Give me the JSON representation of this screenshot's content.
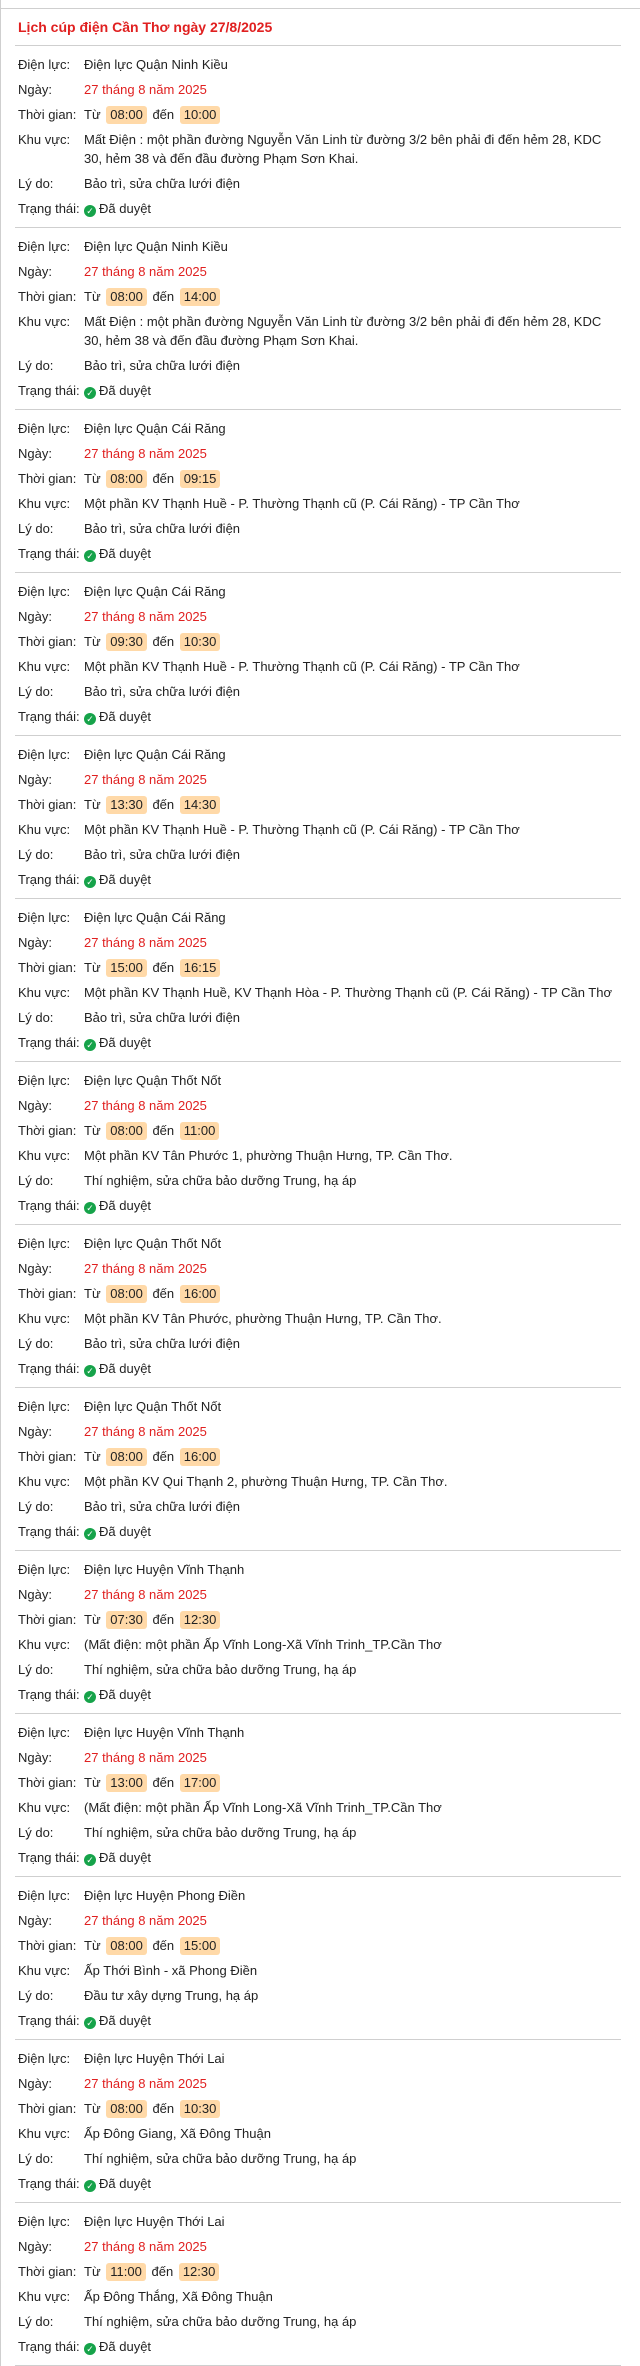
{
  "page": {
    "title": "Lịch cúp điện Cần Thơ ngày 27/8/2025"
  },
  "labels": {
    "unit": "Điện lực:",
    "date": "Ngày:",
    "time": "Thời gian:",
    "from": "Từ",
    "to": "đến",
    "area": "Khu vực:",
    "reason": "Lý do:",
    "status": "Trạng thái:"
  },
  "icons": {
    "status": "check-circle-icon"
  },
  "colors": {
    "title": "#e02020",
    "date": "#e02020",
    "time_badge": "#ffd9a8",
    "approved": "#16a34a"
  },
  "outages": [
    {
      "unit": "Điện lực Quận Ninh Kiều",
      "date": "27 tháng 8 năm 2025",
      "start": "08:00",
      "end": "10:00",
      "area": "Mất Điện : một phần đường Nguyễn Văn Linh từ đường 3/2 bên phải đi đến hẻm 28, KDC 30, hẻm 38 và đến đầu đường Phạm Sơn Khai.",
      "reason": "Bảo trì, sửa chữa lưới điện",
      "status": "Đã duyệt"
    },
    {
      "unit": "Điện lực Quận Ninh Kiều",
      "date": "27 tháng 8 năm 2025",
      "start": "08:00",
      "end": "14:00",
      "area": "Mất Điện : một phần đường Nguyễn Văn Linh từ đường 3/2 bên phải đi đến hẻm 28, KDC 30, hẻm 38 và đến đầu đường Phạm Sơn Khai.",
      "reason": "Bảo trì, sửa chữa lưới điện",
      "status": "Đã duyệt"
    },
    {
      "unit": "Điện lực Quận Cái Răng",
      "date": "27 tháng 8 năm 2025",
      "start": "08:00",
      "end": "09:15",
      "area": "Một phần KV Thạnh Huề - P. Thường Thạnh cũ (P. Cái Răng) - TP Cần Thơ",
      "reason": "Bảo trì, sửa chữa lưới điện",
      "status": "Đã duyệt"
    },
    {
      "unit": "Điện lực Quận Cái Răng",
      "date": "27 tháng 8 năm 2025",
      "start": "09:30",
      "end": "10:30",
      "area": "Một phần KV Thạnh Huề - P. Thường Thạnh cũ (P. Cái Răng) - TP Cần Thơ",
      "reason": "Bảo trì, sửa chữa lưới điện",
      "status": "Đã duyệt"
    },
    {
      "unit": "Điện lực Quận Cái Răng",
      "date": "27 tháng 8 năm 2025",
      "start": "13:30",
      "end": "14:30",
      "area": "Một phần KV Thạnh Huề - P. Thường Thạnh cũ (P. Cái Răng) - TP Cần Thơ",
      "reason": "Bảo trì, sửa chữa lưới điện",
      "status": "Đã duyệt"
    },
    {
      "unit": "Điện lực Quận Cái Răng",
      "date": "27 tháng 8 năm 2025",
      "start": "15:00",
      "end": "16:15",
      "area": "Một phần KV Thạnh Huề, KV Thạnh Hòa - P. Thường Thạnh cũ (P. Cái Răng) - TP Cần Thơ",
      "reason": "Bảo trì, sửa chữa lưới điện",
      "status": "Đã duyệt"
    },
    {
      "unit": "Điện lực Quận Thốt Nốt",
      "date": "27 tháng 8 năm 2025",
      "start": "08:00",
      "end": "11:00",
      "area": "Một phần KV Tân Phước 1, phường Thuận Hưng, TP. Cần Thơ.",
      "reason": "Thí nghiệm, sửa chữa bảo dưỡng Trung, hạ áp",
      "status": "Đã duyệt"
    },
    {
      "unit": "Điện lực Quận Thốt Nốt",
      "date": "27 tháng 8 năm 2025",
      "start": "08:00",
      "end": "16:00",
      "area": "Một phần KV Tân Phước, phường Thuận Hưng, TP. Cần Thơ.",
      "reason": "Bảo trì, sửa chữa lưới điện",
      "status": "Đã duyệt"
    },
    {
      "unit": "Điện lực Quận Thốt Nốt",
      "date": "27 tháng 8 năm 2025",
      "start": "08:00",
      "end": "16:00",
      "area": "Một phần KV Qui Thạnh 2, phường Thuận Hưng, TP. Cần Thơ.",
      "reason": "Bảo trì, sửa chữa lưới điện",
      "status": "Đã duyệt"
    },
    {
      "unit": "Điện lực Huyện Vĩnh Thạnh",
      "date": "27 tháng 8 năm 2025",
      "start": "07:30",
      "end": "12:30",
      "area": "(Mất điện: một phần Ấp Vĩnh Long-Xã Vĩnh Trinh_TP.Cần Thơ",
      "reason": "Thí nghiệm, sửa chữa bảo dưỡng Trung, hạ áp",
      "status": "Đã duyệt"
    },
    {
      "unit": "Điện lực Huyện Vĩnh Thạnh",
      "date": "27 tháng 8 năm 2025",
      "start": "13:00",
      "end": "17:00",
      "area": "(Mất điện: một phần Ấp Vĩnh Long-Xã Vĩnh Trinh_TP.Cần Thơ",
      "reason": "Thí nghiệm, sửa chữa bảo dưỡng Trung, hạ áp",
      "status": "Đã duyệt"
    },
    {
      "unit": "Điện lực Huyện Phong Điền",
      "date": "27 tháng 8 năm 2025",
      "start": "08:00",
      "end": "15:00",
      "area": "Ấp Thới Bình - xã Phong Điền",
      "reason": "Đầu tư xây dựng Trung, hạ áp",
      "status": "Đã duyệt"
    },
    {
      "unit": "Điện lực Huyện Thới Lai",
      "date": "27 tháng 8 năm 2025",
      "start": "08:00",
      "end": "10:30",
      "area": "Ấp Đông Giang, Xã Đông Thuận",
      "reason": "Thí nghiệm, sửa chữa bảo dưỡng Trung, hạ áp",
      "status": "Đã duyệt"
    },
    {
      "unit": "Điện lực Huyện Thới Lai",
      "date": "27 tháng 8 năm 2025",
      "start": "11:00",
      "end": "12:30",
      "area": "Ấp Đông Thắng, Xã Đông Thuận",
      "reason": "Thí nghiệm, sửa chữa bảo dưỡng Trung, hạ áp",
      "status": "Đã duyệt"
    }
  ]
}
